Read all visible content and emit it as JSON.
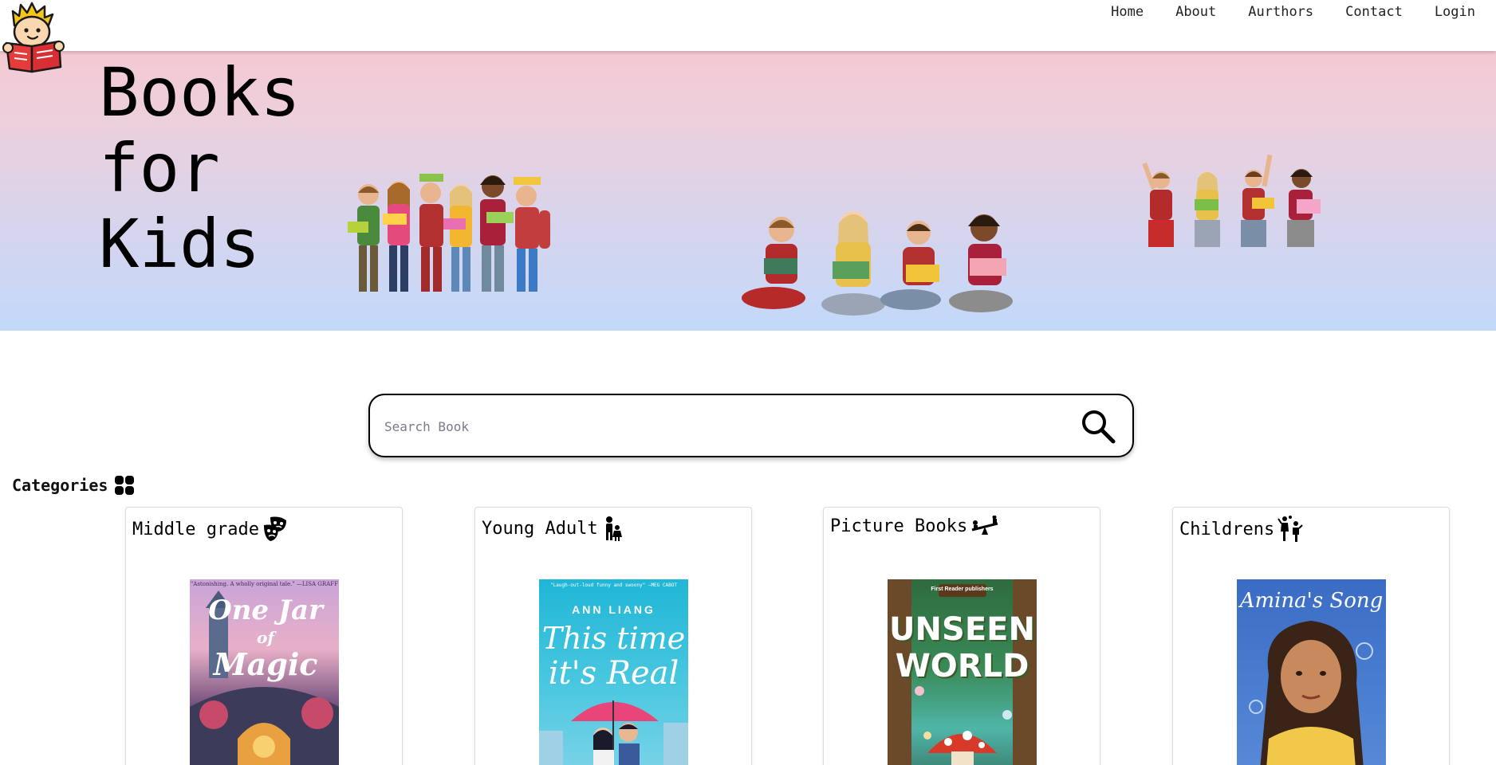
{
  "nav": {
    "links": [
      "Home",
      "About",
      "Aurthors",
      "Contact",
      "Login"
    ]
  },
  "hero": {
    "title": "Books\nfor\nKids"
  },
  "search": {
    "placeholder": "Search Book",
    "value": ""
  },
  "categories": {
    "heading": "Categories",
    "items": [
      {
        "label": "Middle grade",
        "icon": "masks-icon",
        "cover_title_lines": [
          "One Jar",
          "of",
          "Magic"
        ],
        "cover_blurb": "\"Astonishing. A wholly original tale.\" —LISA GRAFF"
      },
      {
        "label": "Young Adult",
        "icon": "family-icon",
        "cover_author": "ANN LIANG",
        "cover_title_lines": [
          "This time",
          "it's Real"
        ],
        "cover_blurb": "\"Laugh-out-loud funny and swoony\" —MEG CABOT"
      },
      {
        "label": "Picture Books",
        "icon": "seesaw-icon",
        "cover_publisher": "First Reader publishers",
        "cover_title_lines": [
          "UNSEEN",
          "WORLD"
        ]
      },
      {
        "label": "Childrens",
        "icon": "kids-playing-icon",
        "cover_title_lines": [
          "Amina's Song"
        ]
      }
    ]
  },
  "colors": {
    "hero_top": "#f4c9d3",
    "hero_bottom": "#c2d9fa",
    "text": "#111111"
  }
}
